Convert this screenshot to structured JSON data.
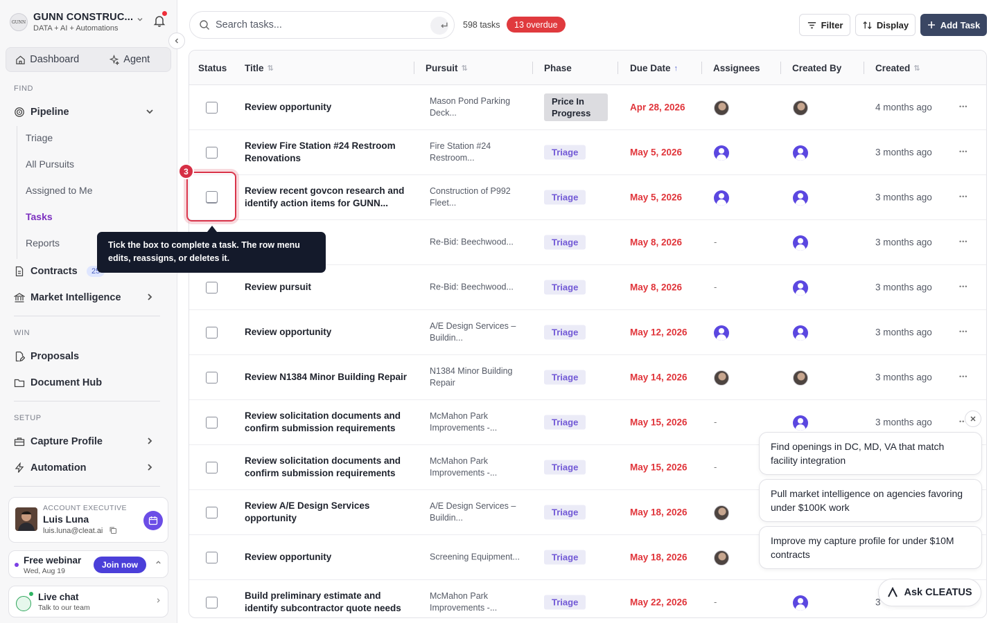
{
  "org": {
    "name": "GUNN CONSTRUC...",
    "subtitle": "DATA + AI + Automations",
    "logo_text": "GUNN"
  },
  "top_tabs": [
    {
      "label": "Dashboard"
    },
    {
      "label": "Agent"
    }
  ],
  "sections": {
    "find": "FIND",
    "win": "WIN",
    "setup": "SETUP"
  },
  "nav": {
    "pipeline": "Pipeline",
    "pipeline_sub": [
      "Triage",
      "All Pursuits",
      "Assigned to Me",
      "Tasks",
      "Reports"
    ],
    "contracts": "Contracts",
    "contracts_count": "25",
    "market_intel": "Market Intelligence",
    "proposals": "Proposals",
    "document_hub": "Document Hub",
    "capture_profile": "Capture Profile",
    "automation": "Automation"
  },
  "account_exec": {
    "label": "ACCOUNT EXECUTIVE",
    "name": "Luis Luna",
    "email": "luis.luna@cleat.ai"
  },
  "webinar": {
    "title": "Free webinar",
    "date": "Wed, Aug 19",
    "button": "Join now"
  },
  "live_chat": {
    "title": "Live chat",
    "subtitle": "Talk to our team"
  },
  "toolbar": {
    "search_placeholder": "Search tasks...",
    "task_count": "598 tasks",
    "overdue": "13 overdue",
    "filter": "Filter",
    "display": "Display",
    "add_task": "Add Task"
  },
  "columns": [
    "Status",
    "Title",
    "Pursuit",
    "Phase",
    "Due Date",
    "Assignees",
    "Created By",
    "Created"
  ],
  "rows": [
    {
      "title": "Review opportunity",
      "pursuit": "Mason Pond Parking Deck...",
      "phase": "Price In Progress",
      "due": "Apr 28, 2026",
      "assignee": "photo",
      "creator": "photo",
      "created": "4 months ago"
    },
    {
      "title": "Review Fire Station #24 Restroom Renovations",
      "pursuit": "Fire Station #24 Restroom...",
      "phase": "Triage",
      "due": "May 5, 2026",
      "assignee": "default",
      "creator": "default",
      "created": "3 months ago"
    },
    {
      "title": "Review recent govcon research and identify action items for GUNN...",
      "pursuit": "Construction of P992 Fleet...",
      "phase": "Triage",
      "due": "May 5, 2026",
      "assignee": "default",
      "creator": "default",
      "created": "3 months ago"
    },
    {
      "title": "",
      "pursuit": "Re-Bid: Beechwood...",
      "phase": "Triage",
      "due": "May 8, 2026",
      "assignee": "-",
      "creator": "default",
      "created": "3 months ago"
    },
    {
      "title": "Review pursuit",
      "pursuit": "Re-Bid: Beechwood...",
      "phase": "Triage",
      "due": "May 8, 2026",
      "assignee": "-",
      "creator": "default",
      "created": "3 months ago"
    },
    {
      "title": "Review opportunity",
      "pursuit": "A/E Design Services – Buildin...",
      "phase": "Triage",
      "due": "May 12, 2026",
      "assignee": "default",
      "creator": "default",
      "created": "3 months ago"
    },
    {
      "title": "Review N1384 Minor Building Repair",
      "pursuit": "N1384 Minor Building Repair",
      "phase": "Triage",
      "due": "May 14, 2026",
      "assignee": "photo",
      "creator": "photo",
      "created": "3 months ago"
    },
    {
      "title": "Review solicitation documents and confirm submission requirements",
      "pursuit": "McMahon Park Improvements -...",
      "phase": "Triage",
      "due": "May 15, 2026",
      "assignee": "-",
      "creator": "default",
      "created": "3 months ago"
    },
    {
      "title": "Review solicitation documents and confirm submission requirements",
      "pursuit": "McMahon Park Improvements -...",
      "phase": "Triage",
      "due": "May 15, 2026",
      "assignee": "-",
      "creator": "",
      "created": ""
    },
    {
      "title": "Review A/E Design Services opportunity",
      "pursuit": "A/E Design Services – Buildin...",
      "phase": "Triage",
      "due": "May 18, 2026",
      "assignee": "photo",
      "creator": "",
      "created": ""
    },
    {
      "title": "Review opportunity",
      "pursuit": "Screening Equipment...",
      "phase": "Triage",
      "due": "May 18, 2026",
      "assignee": "photo",
      "creator": "",
      "created": ""
    },
    {
      "title": "Build preliminary estimate and identify subcontractor quote needs",
      "pursuit": "McMahon Park Improvements -...",
      "phase": "Triage",
      "due": "May 22, 2026",
      "assignee": "-",
      "creator": "default",
      "created": "3"
    }
  ],
  "onboarding": {
    "step": "3",
    "text": "Tick the box to complete a task. The row menu edits, reassigns, or deletes it."
  },
  "suggestions": [
    "Find openings in DC, MD, VA that match facility integration",
    "Pull market intelligence on agencies favoring under $100K work",
    "Improve my capture profile for under $10M contracts"
  ],
  "ask_button": "Ask CLEATUS",
  "colors": {
    "accent": "#7b2fbf",
    "overdue": "#e03a3e",
    "due_text": "#e0343a",
    "primary_btn": "#3a4663",
    "tooltip_bg": "#141a2b"
  }
}
